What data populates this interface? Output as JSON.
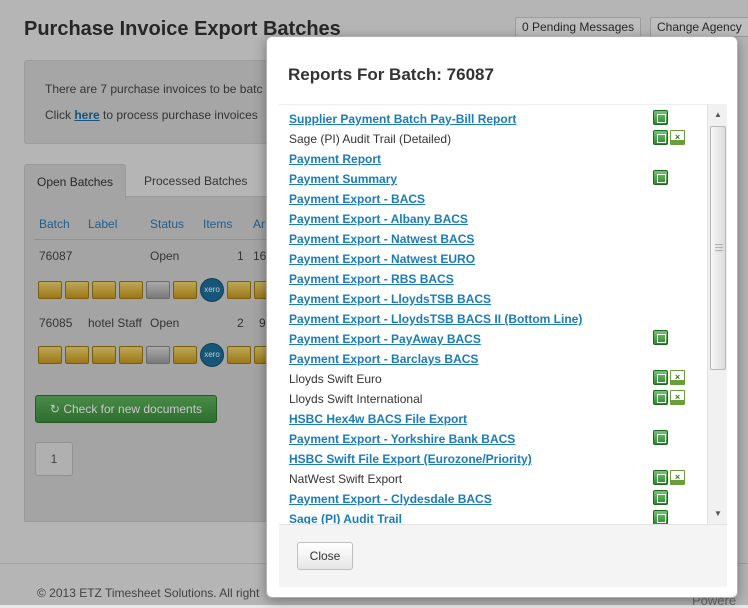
{
  "page": {
    "title": "Purchase Invoice Export Batches",
    "pending_messages": "0 Pending Messages",
    "change_agency": "Change Agency",
    "info_line1": "There are 7 purchase invoices to be batc",
    "click_prefix": "Click ",
    "here_link": "here",
    "click_suffix": " to process purchase invoices",
    "tabs": [
      "Open Batches",
      "Processed Batches"
    ],
    "columns": [
      "Batch",
      "Label",
      "Status",
      "Items",
      "Ar"
    ],
    "rows": [
      {
        "batch": "76087",
        "label": "",
        "status": "Open",
        "items": "1",
        "amount": "16"
      },
      {
        "batch": "76085",
        "label": "hotel Staff",
        "status": "Open",
        "items": "2",
        "amount": "9"
      }
    ],
    "xero_label": "xero",
    "check_button": "Check for new documents",
    "pager_current": "1",
    "footer": "© 2013 ETZ Timesheet Solutions. All right",
    "powered": "Powere"
  },
  "modal": {
    "title": "Reports For Batch: 76087",
    "close_label": "Close",
    "reports": [
      {
        "label": "Supplier Payment Batch Pay-Bill Report",
        "link": true,
        "icons": [
          "excel"
        ]
      },
      {
        "label": "Sage (PI) Audit Trail (Detailed)",
        "link": false,
        "icons": [
          "excel",
          "csv"
        ]
      },
      {
        "label": "Payment Report",
        "link": true,
        "icons": []
      },
      {
        "label": "Payment Summary",
        "link": true,
        "icons": [
          "excel"
        ]
      },
      {
        "label": "Payment Export - BACS",
        "link": true,
        "icons": []
      },
      {
        "label": "Payment Export - Albany BACS",
        "link": true,
        "icons": []
      },
      {
        "label": "Payment Export - Natwest BACS",
        "link": true,
        "icons": []
      },
      {
        "label": "Payment Export - Natwest EURO",
        "link": true,
        "icons": []
      },
      {
        "label": "Payment Export - RBS BACS",
        "link": true,
        "icons": []
      },
      {
        "label": "Payment Export - LloydsTSB BACS",
        "link": true,
        "icons": []
      },
      {
        "label": "Payment Export - LloydsTSB BACS II (Bottom Line)",
        "link": true,
        "icons": []
      },
      {
        "label": "Payment Export - PayAway BACS",
        "link": true,
        "icons": [
          "excel"
        ]
      },
      {
        "label": "Payment Export - Barclays BACS",
        "link": true,
        "icons": []
      },
      {
        "label": "Lloyds Swift Euro",
        "link": false,
        "icons": [
          "excel",
          "csv"
        ]
      },
      {
        "label": "Lloyds Swift International",
        "link": false,
        "icons": [
          "excel",
          "csv"
        ]
      },
      {
        "label": "HSBC Hex4w BACS File Export",
        "link": true,
        "icons": []
      },
      {
        "label": "Payment Export - Yorkshire Bank BACS",
        "link": true,
        "icons": [
          "excel"
        ]
      },
      {
        "label": "HSBC Swift File Export (Eurozone/Priority)",
        "link": true,
        "icons": []
      },
      {
        "label": "NatWest Swift Export",
        "link": false,
        "icons": [
          "excel",
          "csv"
        ]
      },
      {
        "label": "Payment Export - Clydesdale BACS",
        "link": true,
        "icons": [
          "excel"
        ]
      },
      {
        "label": "Sage (PI) Audit Trail",
        "link": true,
        "icons": [
          "excel"
        ]
      }
    ]
  }
}
